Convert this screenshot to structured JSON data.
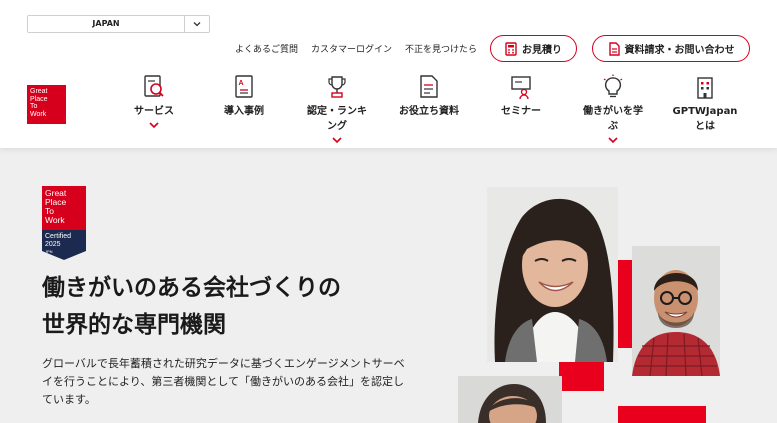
{
  "header": {
    "country_select": {
      "value": "JAPAN"
    },
    "utility_links": [
      "よくあるご質問",
      "カスタマーログイン",
      "不正を見つけたら"
    ],
    "quote_button": "お見積り",
    "contact_button": "資料請求・お問い合わせ",
    "logo_lines": [
      "Great",
      "Place",
      "To",
      "Work"
    ],
    "nav": [
      {
        "label_lines": [
          "サービス"
        ],
        "icon": "service-icon",
        "has_dropdown": true
      },
      {
        "label_lines": [
          "導入事例"
        ],
        "icon": "case-study-icon",
        "has_dropdown": false
      },
      {
        "label_lines": [
          "認定・ランキ",
          "ング"
        ],
        "icon": "trophy-icon",
        "has_dropdown": true
      },
      {
        "label_lines": [
          "お役立ち資料"
        ],
        "icon": "document-icon",
        "has_dropdown": false
      },
      {
        "label_lines": [
          "セミナー"
        ],
        "icon": "seminar-icon",
        "has_dropdown": false
      },
      {
        "label_lines": [
          "働きがいを学",
          "ぶ"
        ],
        "icon": "lightbulb-icon",
        "has_dropdown": true
      },
      {
        "label_lines": [
          "GPTWJapan",
          "とは"
        ],
        "icon": "building-icon",
        "has_dropdown": false
      }
    ]
  },
  "hero": {
    "badge": {
      "top_lines": [
        "Great",
        "Place",
        "To",
        "Work"
      ],
      "certified": "Certified",
      "year": "2025",
      "country": "JPN"
    },
    "headline_lines": [
      "働きがいのある会社づくりの",
      "世界的な専門機関"
    ],
    "description_lines": [
      "グローバルで長年蓄積された研究データに基づくエンゲージメントサーベ",
      "イを行うことにより、第三者機関として「働きがいのある会社」を認定し",
      "ています。"
    ]
  },
  "colors": {
    "brand_red": "#d6001c",
    "badge_navy": "#1c2a4f",
    "hero_bg": "#efefef"
  }
}
